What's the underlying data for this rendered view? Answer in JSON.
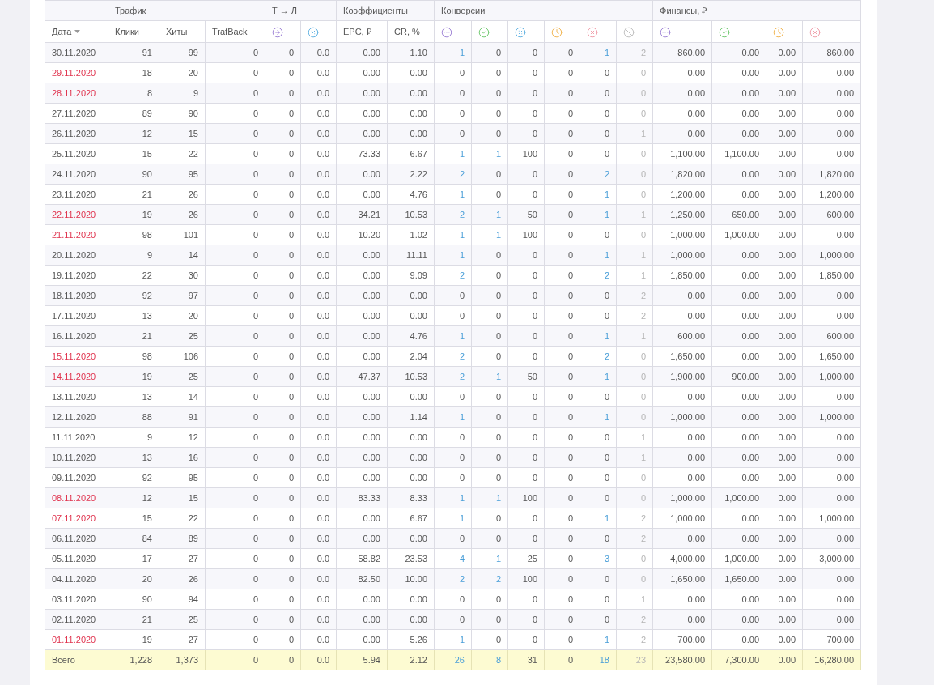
{
  "groups": [
    "Трафик",
    "Т → Л",
    "Коэффициенты",
    "Конверсии",
    "Финансы, ₽"
  ],
  "columns": [
    {
      "kind": "text",
      "label": "Дата"
    },
    {
      "kind": "text",
      "label": "Клики"
    },
    {
      "kind": "text",
      "label": "Хиты"
    },
    {
      "kind": "text",
      "label": "TrafBack"
    },
    {
      "kind": "icon"
    },
    {
      "kind": "icon"
    },
    {
      "kind": "text",
      "label": "EPC, ₽"
    },
    {
      "kind": "text",
      "label": "CR, %"
    },
    {
      "kind": "icon"
    },
    {
      "kind": "icon"
    },
    {
      "kind": "icon"
    },
    {
      "kind": "icon"
    },
    {
      "kind": "icon"
    },
    {
      "kind": "icon"
    },
    {
      "kind": "icon"
    },
    {
      "kind": "icon"
    },
    {
      "kind": "icon"
    },
    {
      "kind": "icon"
    }
  ],
  "rows": [
    {
      "date": "30.11.2020",
      "weekend": false,
      "cells": [
        "91",
        "99",
        "0",
        "0",
        "0.0",
        "0.00",
        "1.10",
        "1",
        "0",
        "0",
        "0",
        "1",
        "2",
        "860.00",
        "0.00",
        "0.00",
        "860.00"
      ]
    },
    {
      "date": "29.11.2020",
      "weekend": true,
      "cells": [
        "18",
        "20",
        "0",
        "0",
        "0.0",
        "0.00",
        "0.00",
        "0",
        "0",
        "0",
        "0",
        "0",
        "0",
        "0.00",
        "0.00",
        "0.00",
        "0.00"
      ]
    },
    {
      "date": "28.11.2020",
      "weekend": true,
      "cells": [
        "8",
        "9",
        "0",
        "0",
        "0.0",
        "0.00",
        "0.00",
        "0",
        "0",
        "0",
        "0",
        "0",
        "0",
        "0.00",
        "0.00",
        "0.00",
        "0.00"
      ]
    },
    {
      "date": "27.11.2020",
      "weekend": false,
      "cells": [
        "89",
        "90",
        "0",
        "0",
        "0.0",
        "0.00",
        "0.00",
        "0",
        "0",
        "0",
        "0",
        "0",
        "0",
        "0.00",
        "0.00",
        "0.00",
        "0.00"
      ]
    },
    {
      "date": "26.11.2020",
      "weekend": false,
      "cells": [
        "12",
        "15",
        "0",
        "0",
        "0.0",
        "0.00",
        "0.00",
        "0",
        "0",
        "0",
        "0",
        "0",
        "1",
        "0.00",
        "0.00",
        "0.00",
        "0.00"
      ]
    },
    {
      "date": "25.11.2020",
      "weekend": false,
      "cells": [
        "15",
        "22",
        "0",
        "0",
        "0.0",
        "73.33",
        "6.67",
        "1",
        "1",
        "100",
        "0",
        "0",
        "0",
        "1,100.00",
        "1,100.00",
        "0.00",
        "0.00"
      ]
    },
    {
      "date": "24.11.2020",
      "weekend": false,
      "cells": [
        "90",
        "95",
        "0",
        "0",
        "0.0",
        "0.00",
        "2.22",
        "2",
        "0",
        "0",
        "0",
        "2",
        "0",
        "1,820.00",
        "0.00",
        "0.00",
        "1,820.00"
      ]
    },
    {
      "date": "23.11.2020",
      "weekend": false,
      "cells": [
        "21",
        "26",
        "0",
        "0",
        "0.0",
        "0.00",
        "4.76",
        "1",
        "0",
        "0",
        "0",
        "1",
        "0",
        "1,200.00",
        "0.00",
        "0.00",
        "1,200.00"
      ]
    },
    {
      "date": "22.11.2020",
      "weekend": true,
      "cells": [
        "19",
        "26",
        "0",
        "0",
        "0.0",
        "34.21",
        "10.53",
        "2",
        "1",
        "50",
        "0",
        "1",
        "1",
        "1,250.00",
        "650.00",
        "0.00",
        "600.00"
      ]
    },
    {
      "date": "21.11.2020",
      "weekend": true,
      "cells": [
        "98",
        "101",
        "0",
        "0",
        "0.0",
        "10.20",
        "1.02",
        "1",
        "1",
        "100",
        "0",
        "0",
        "0",
        "1,000.00",
        "1,000.00",
        "0.00",
        "0.00"
      ]
    },
    {
      "date": "20.11.2020",
      "weekend": false,
      "cells": [
        "9",
        "14",
        "0",
        "0",
        "0.0",
        "0.00",
        "11.11",
        "1",
        "0",
        "0",
        "0",
        "1",
        "1",
        "1,000.00",
        "0.00",
        "0.00",
        "1,000.00"
      ]
    },
    {
      "date": "19.11.2020",
      "weekend": false,
      "cells": [
        "22",
        "30",
        "0",
        "0",
        "0.0",
        "0.00",
        "9.09",
        "2",
        "0",
        "0",
        "0",
        "2",
        "1",
        "1,850.00",
        "0.00",
        "0.00",
        "1,850.00"
      ]
    },
    {
      "date": "18.11.2020",
      "weekend": false,
      "cells": [
        "92",
        "97",
        "0",
        "0",
        "0.0",
        "0.00",
        "0.00",
        "0",
        "0",
        "0",
        "0",
        "0",
        "2",
        "0.00",
        "0.00",
        "0.00",
        "0.00"
      ]
    },
    {
      "date": "17.11.2020",
      "weekend": false,
      "cells": [
        "13",
        "20",
        "0",
        "0",
        "0.0",
        "0.00",
        "0.00",
        "0",
        "0",
        "0",
        "0",
        "0",
        "2",
        "0.00",
        "0.00",
        "0.00",
        "0.00"
      ]
    },
    {
      "date": "16.11.2020",
      "weekend": false,
      "cells": [
        "21",
        "25",
        "0",
        "0",
        "0.0",
        "0.00",
        "4.76",
        "1",
        "0",
        "0",
        "0",
        "1",
        "1",
        "600.00",
        "0.00",
        "0.00",
        "600.00"
      ]
    },
    {
      "date": "15.11.2020",
      "weekend": true,
      "cells": [
        "98",
        "106",
        "0",
        "0",
        "0.0",
        "0.00",
        "2.04",
        "2",
        "0",
        "0",
        "0",
        "2",
        "0",
        "1,650.00",
        "0.00",
        "0.00",
        "1,650.00"
      ]
    },
    {
      "date": "14.11.2020",
      "weekend": true,
      "cells": [
        "19",
        "25",
        "0",
        "0",
        "0.0",
        "47.37",
        "10.53",
        "2",
        "1",
        "50",
        "0",
        "1",
        "0",
        "1,900.00",
        "900.00",
        "0.00",
        "1,000.00"
      ]
    },
    {
      "date": "13.11.2020",
      "weekend": false,
      "cells": [
        "13",
        "14",
        "0",
        "0",
        "0.0",
        "0.00",
        "0.00",
        "0",
        "0",
        "0",
        "0",
        "0",
        "0",
        "0.00",
        "0.00",
        "0.00",
        "0.00"
      ]
    },
    {
      "date": "12.11.2020",
      "weekend": false,
      "cells": [
        "88",
        "91",
        "0",
        "0",
        "0.0",
        "0.00",
        "1.14",
        "1",
        "0",
        "0",
        "0",
        "1",
        "0",
        "1,000.00",
        "0.00",
        "0.00",
        "1,000.00"
      ]
    },
    {
      "date": "11.11.2020",
      "weekend": false,
      "cells": [
        "9",
        "12",
        "0",
        "0",
        "0.0",
        "0.00",
        "0.00",
        "0",
        "0",
        "0",
        "0",
        "0",
        "1",
        "0.00",
        "0.00",
        "0.00",
        "0.00"
      ]
    },
    {
      "date": "10.11.2020",
      "weekend": false,
      "cells": [
        "13",
        "16",
        "0",
        "0",
        "0.0",
        "0.00",
        "0.00",
        "0",
        "0",
        "0",
        "0",
        "0",
        "1",
        "0.00",
        "0.00",
        "0.00",
        "0.00"
      ]
    },
    {
      "date": "09.11.2020",
      "weekend": false,
      "cells": [
        "92",
        "95",
        "0",
        "0",
        "0.0",
        "0.00",
        "0.00",
        "0",
        "0",
        "0",
        "0",
        "0",
        "0",
        "0.00",
        "0.00",
        "0.00",
        "0.00"
      ]
    },
    {
      "date": "08.11.2020",
      "weekend": true,
      "cells": [
        "12",
        "15",
        "0",
        "0",
        "0.0",
        "83.33",
        "8.33",
        "1",
        "1",
        "100",
        "0",
        "0",
        "0",
        "1,000.00",
        "1,000.00",
        "0.00",
        "0.00"
      ]
    },
    {
      "date": "07.11.2020",
      "weekend": true,
      "cells": [
        "15",
        "22",
        "0",
        "0",
        "0.0",
        "0.00",
        "6.67",
        "1",
        "0",
        "0",
        "0",
        "1",
        "2",
        "1,000.00",
        "0.00",
        "0.00",
        "1,000.00"
      ]
    },
    {
      "date": "06.11.2020",
      "weekend": false,
      "cells": [
        "84",
        "89",
        "0",
        "0",
        "0.0",
        "0.00",
        "0.00",
        "0",
        "0",
        "0",
        "0",
        "0",
        "2",
        "0.00",
        "0.00",
        "0.00",
        "0.00"
      ]
    },
    {
      "date": "05.11.2020",
      "weekend": false,
      "cells": [
        "17",
        "27",
        "0",
        "0",
        "0.0",
        "58.82",
        "23.53",
        "4",
        "1",
        "25",
        "0",
        "3",
        "0",
        "4,000.00",
        "1,000.00",
        "0.00",
        "3,000.00"
      ]
    },
    {
      "date": "04.11.2020",
      "weekend": false,
      "cells": [
        "20",
        "26",
        "0",
        "0",
        "0.0",
        "82.50",
        "10.00",
        "2",
        "2",
        "100",
        "0",
        "0",
        "0",
        "1,650.00",
        "1,650.00",
        "0.00",
        "0.00"
      ]
    },
    {
      "date": "03.11.2020",
      "weekend": false,
      "cells": [
        "90",
        "94",
        "0",
        "0",
        "0.0",
        "0.00",
        "0.00",
        "0",
        "0",
        "0",
        "0",
        "0",
        "1",
        "0.00",
        "0.00",
        "0.00",
        "0.00"
      ]
    },
    {
      "date": "02.11.2020",
      "weekend": false,
      "cells": [
        "21",
        "25",
        "0",
        "0",
        "0.0",
        "0.00",
        "0.00",
        "0",
        "0",
        "0",
        "0",
        "0",
        "2",
        "0.00",
        "0.00",
        "0.00",
        "0.00"
      ]
    },
    {
      "date": "01.11.2020",
      "weekend": true,
      "cells": [
        "19",
        "27",
        "0",
        "0",
        "0.0",
        "0.00",
        "5.26",
        "1",
        "0",
        "0",
        "0",
        "1",
        "2",
        "700.00",
        "0.00",
        "0.00",
        "700.00"
      ]
    }
  ],
  "total": {
    "label": "Всего",
    "cells": [
      "1,228",
      "1,373",
      "0",
      "0",
      "0.0",
      "5.94",
      "2.12",
      "26",
      "8",
      "31",
      "0",
      "18",
      "23",
      "23,580.00",
      "7,300.00",
      "0.00",
      "16,280.00"
    ]
  }
}
